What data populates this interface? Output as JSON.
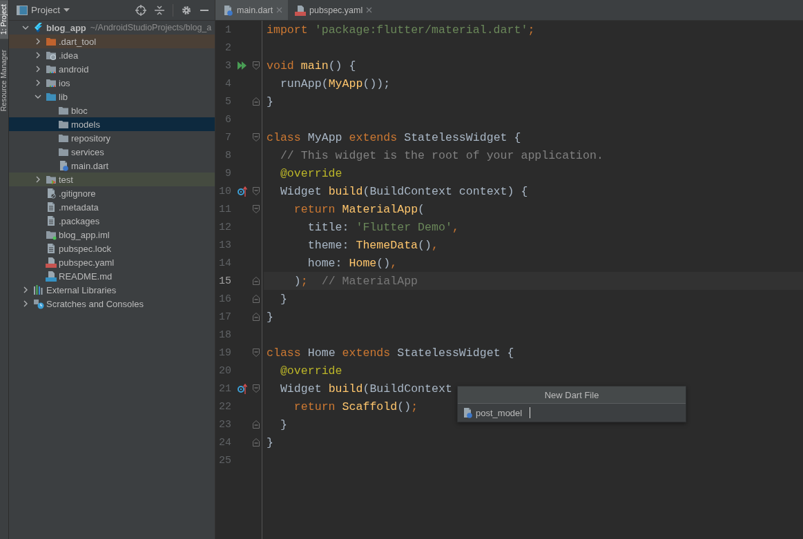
{
  "tool_strip": [
    {
      "label": "1: Project",
      "selected": true
    },
    {
      "label": "Resource Manager",
      "selected": false
    }
  ],
  "project": {
    "title": "Project",
    "tree": [
      {
        "label": "blog_app",
        "path": "~/AndroidStudioProjects/blog_a",
        "kind": "flutter",
        "expanded": true,
        "selected": false,
        "children": [
          {
            "label": ".dart_tool",
            "kind": "folder-excluded",
            "expanded": false,
            "selected": false,
            "color": "#4b4036"
          },
          {
            "label": ".idea",
            "kind": "folder-idea",
            "expanded": false,
            "selected": false
          },
          {
            "label": "android",
            "kind": "folder-module",
            "expanded": false,
            "selected": false
          },
          {
            "label": "ios",
            "kind": "folder-module",
            "expanded": false,
            "selected": false
          },
          {
            "label": "lib",
            "kind": "folder-source",
            "expanded": true,
            "selected": false,
            "children": [
              {
                "label": "bloc",
                "kind": "folder",
                "selected": false
              },
              {
                "label": "models",
                "kind": "folder",
                "selected": true
              },
              {
                "label": "repository",
                "kind": "folder",
                "selected": false
              },
              {
                "label": "services",
                "kind": "folder",
                "selected": false
              },
              {
                "label": "main.dart",
                "kind": "dart",
                "selected": false
              }
            ]
          },
          {
            "label": "test",
            "kind": "folder-test",
            "expanded": false,
            "selected": false,
            "color": "#454b40"
          },
          {
            "label": ".gitignore",
            "kind": "file-ignore",
            "selected": false
          },
          {
            "label": ".metadata",
            "kind": "file",
            "selected": false
          },
          {
            "label": ".packages",
            "kind": "file",
            "selected": false
          },
          {
            "label": "blog_app.iml",
            "kind": "module-file",
            "selected": false
          },
          {
            "label": "pubspec.lock",
            "kind": "file",
            "selected": false
          },
          {
            "label": "pubspec.yaml",
            "kind": "yaml",
            "selected": false
          },
          {
            "label": "README.md",
            "kind": "markdown",
            "selected": false
          }
        ]
      },
      {
        "label": "External Libraries",
        "kind": "libraries",
        "expanded": false,
        "selected": false
      },
      {
        "label": "Scratches and Consoles",
        "kind": "scratches",
        "expanded": false,
        "selected": false
      }
    ]
  },
  "tabs": [
    {
      "label": "main.dart",
      "kind": "dart",
      "selected": true
    },
    {
      "label": "pubspec.yaml",
      "kind": "yaml",
      "selected": false
    }
  ],
  "editor": {
    "lines": [
      {
        "number": "1",
        "tokens": [
          {
            "kind": "kw",
            "text": "import "
          },
          {
            "kind": "str",
            "text": "'package:flutter/material.dart'"
          },
          {
            "kind": "kw",
            "text": ";"
          }
        ]
      },
      {
        "number": "2"
      },
      {
        "number": "3",
        "marker": {
          "kind": "run"
        },
        "fold": {
          "kind": "start"
        },
        "tokens": [
          {
            "kind": "kw",
            "text": "void "
          },
          {
            "kind": "fn",
            "text": "main"
          },
          {
            "kind": "plain",
            "text": "() {"
          }
        ]
      },
      {
        "number": "4",
        "tokens": [
          {
            "kind": "plain",
            "text": "  runApp("
          },
          {
            "kind": "fn",
            "text": "MyApp"
          },
          {
            "kind": "plain",
            "text": "());"
          }
        ]
      },
      {
        "number": "5",
        "fold": {
          "kind": "end"
        },
        "tokens": [
          {
            "kind": "plain",
            "text": "}"
          }
        ]
      },
      {
        "number": "6"
      },
      {
        "number": "7",
        "fold": {
          "kind": "start"
        },
        "tokens": [
          {
            "kind": "kw",
            "text": "class"
          },
          {
            "kind": "plain",
            "text": " MyApp "
          },
          {
            "kind": "kw",
            "text": "extends"
          },
          {
            "kind": "plain",
            "text": " StatelessWidget {"
          }
        ]
      },
      {
        "number": "8",
        "tokens": [
          {
            "kind": "comment",
            "text": "  // This widget is the root of your application."
          }
        ]
      },
      {
        "number": "9",
        "tokens": [
          {
            "kind": "ann",
            "text": "  @override"
          }
        ]
      },
      {
        "number": "10",
        "marker": {
          "kind": "override"
        },
        "fold": {
          "kind": "start"
        },
        "tokens": [
          {
            "kind": "plain",
            "text": "  Widget "
          },
          {
            "kind": "fn",
            "text": "build"
          },
          {
            "kind": "plain",
            "text": "(BuildContext context) {"
          }
        ]
      },
      {
        "number": "11",
        "fold": {
          "kind": "start"
        },
        "tokens": [
          {
            "kind": "kw",
            "text": "    return "
          },
          {
            "kind": "fn",
            "text": "MaterialApp"
          },
          {
            "kind": "plain",
            "text": "("
          }
        ]
      },
      {
        "number": "12",
        "tokens": [
          {
            "kind": "plain",
            "text": "      title: "
          },
          {
            "kind": "str",
            "text": "'Flutter Demo'"
          },
          {
            "kind": "kw",
            "text": ","
          }
        ]
      },
      {
        "number": "13",
        "tokens": [
          {
            "kind": "plain",
            "text": "      theme: "
          },
          {
            "kind": "fn",
            "text": "ThemeData"
          },
          {
            "kind": "plain",
            "text": "()"
          },
          {
            "kind": "kw",
            "text": ","
          }
        ]
      },
      {
        "number": "14",
        "tokens": [
          {
            "kind": "plain",
            "text": "      home: "
          },
          {
            "kind": "fn",
            "text": "Home"
          },
          {
            "kind": "plain",
            "text": "()"
          },
          {
            "kind": "kw",
            "text": ","
          }
        ]
      },
      {
        "number": "15",
        "current": true,
        "fold": {
          "kind": "end"
        },
        "tokens": [
          {
            "kind": "plain",
            "text": "    )"
          },
          {
            "kind": "kw",
            "text": ";  "
          },
          {
            "kind": "hint",
            "text": "// MaterialApp"
          }
        ]
      },
      {
        "number": "16",
        "fold": {
          "kind": "end"
        },
        "tokens": [
          {
            "kind": "plain",
            "text": "  }"
          }
        ]
      },
      {
        "number": "17",
        "fold": {
          "kind": "end"
        },
        "tokens": [
          {
            "kind": "plain",
            "text": "}"
          }
        ]
      },
      {
        "number": "18"
      },
      {
        "number": "19",
        "fold": {
          "kind": "start"
        },
        "tokens": [
          {
            "kind": "kw",
            "text": "class"
          },
          {
            "kind": "plain",
            "text": " Home "
          },
          {
            "kind": "kw",
            "text": "extends"
          },
          {
            "kind": "plain",
            "text": " StatelessWidget {"
          }
        ]
      },
      {
        "number": "20",
        "tokens": [
          {
            "kind": "ann",
            "text": "  @override"
          }
        ]
      },
      {
        "number": "21",
        "marker": {
          "kind": "override"
        },
        "fold": {
          "kind": "start"
        },
        "tokens": [
          {
            "kind": "plain",
            "text": "  Widget "
          },
          {
            "kind": "fn",
            "text": "build"
          },
          {
            "kind": "plain",
            "text": "(BuildContext"
          }
        ]
      },
      {
        "number": "22",
        "tokens": [
          {
            "kind": "kw",
            "text": "    return "
          },
          {
            "kind": "fn",
            "text": "Scaffold"
          },
          {
            "kind": "plain",
            "text": "()"
          },
          {
            "kind": "kw",
            "text": ";"
          }
        ]
      },
      {
        "number": "23",
        "fold": {
          "kind": "end"
        },
        "tokens": [
          {
            "kind": "plain",
            "text": "  }"
          }
        ]
      },
      {
        "number": "24",
        "fold": {
          "kind": "end"
        },
        "tokens": [
          {
            "kind": "plain",
            "text": "}"
          }
        ]
      },
      {
        "number": "25"
      }
    ]
  },
  "popup": {
    "title": "New Dart File",
    "value": "post_model"
  }
}
